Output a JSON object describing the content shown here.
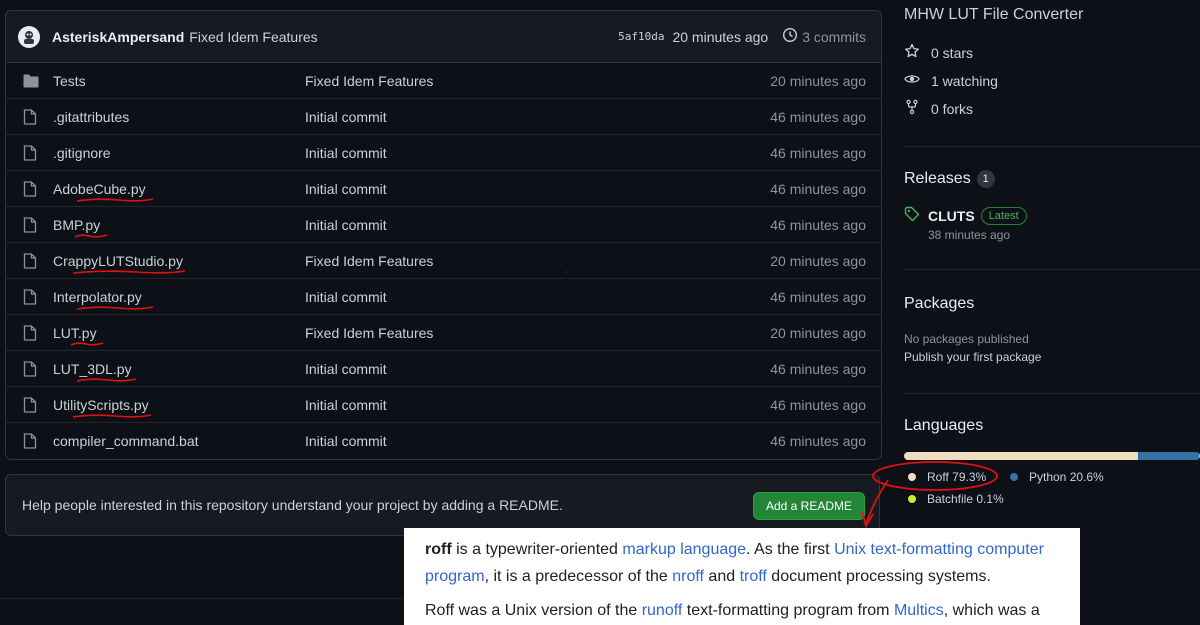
{
  "commit": {
    "author": "AsteriskAmpersand",
    "message": "Fixed Idem Features",
    "sha": "5af10da",
    "time": "20 minutes ago",
    "commits_label": "3 commits"
  },
  "files": [
    {
      "name": "Tests",
      "type": "folder",
      "message": "Fixed Idem Features",
      "time": "20 minutes ago",
      "underlined": false
    },
    {
      "name": ".gitattributes",
      "type": "file",
      "message": "Initial commit",
      "time": "46 minutes ago",
      "underlined": false
    },
    {
      "name": ".gitignore",
      "type": "file",
      "message": "Initial commit",
      "time": "46 minutes ago",
      "underlined": false
    },
    {
      "name": "AdobeCube.py",
      "type": "file",
      "message": "Initial commit",
      "time": "46 minutes ago",
      "underlined": true
    },
    {
      "name": "BMP.py",
      "type": "file",
      "message": "Initial commit",
      "time": "46 minutes ago",
      "underlined": true
    },
    {
      "name": "CrappyLUTStudio.py",
      "type": "file",
      "message": "Fixed Idem Features",
      "time": "20 minutes ago",
      "underlined": true
    },
    {
      "name": "Interpolator.py",
      "type": "file",
      "message": "Initial commit",
      "time": "46 minutes ago",
      "underlined": true
    },
    {
      "name": "LUT.py",
      "type": "file",
      "message": "Fixed Idem Features",
      "time": "20 minutes ago",
      "underlined": true
    },
    {
      "name": "LUT_3DL.py",
      "type": "file",
      "message": "Initial commit",
      "time": "46 minutes ago",
      "underlined": true
    },
    {
      "name": "UtilityScripts.py",
      "type": "file",
      "message": "Initial commit",
      "time": "46 minutes ago",
      "underlined": true
    },
    {
      "name": "compiler_command.bat",
      "type": "file",
      "message": "Initial commit",
      "time": "46 minutes ago",
      "underlined": false
    }
  ],
  "readme_prompt": {
    "text": "Help people interested in this repository understand your project by adding a README.",
    "button": "Add a README"
  },
  "sidebar": {
    "about": "MHW LUT File Converter",
    "stars": "0 stars",
    "watching": "1 watching",
    "forks": "0 forks",
    "releases_title": "Releases",
    "releases_count": "1",
    "release_name": "CLUTS",
    "release_badge": "Latest",
    "release_time": "38 minutes ago",
    "packages_title": "Packages",
    "packages_none": "No packages published",
    "packages_link": "Publish your first package",
    "languages_title": "Languages",
    "languages": [
      {
        "name": "Roff",
        "percent": "79.3%",
        "share": 79.3,
        "color": "#ecdebe"
      },
      {
        "name": "Python",
        "percent": "20.6%",
        "share": 20.6,
        "color": "#3572a5"
      },
      {
        "name": "Batchfile",
        "percent": "0.1%",
        "share": 0.1,
        "color": "#c1f12e"
      }
    ]
  },
  "wiki": {
    "p1": [
      {
        "t": "roff",
        "style": "bold"
      },
      {
        "t": " is a typewriter-oriented ",
        "style": "text"
      },
      {
        "t": "markup language",
        "style": "link"
      },
      {
        "t": ". As the first ",
        "style": "text"
      },
      {
        "t": "Unix text-formatting computer program",
        "style": "link"
      },
      {
        "t": ", it is a predecessor of the ",
        "style": "text"
      },
      {
        "t": "nroff",
        "style": "link"
      },
      {
        "t": " and ",
        "style": "text"
      },
      {
        "t": "troff",
        "style": "link"
      },
      {
        "t": " document processing systems.",
        "style": "text"
      }
    ],
    "p2": [
      {
        "t": "Roff was a Unix version of the ",
        "style": "text"
      },
      {
        "t": "runoff",
        "style": "link"
      },
      {
        "t": " text-formatting program from ",
        "style": "text"
      },
      {
        "t": "Multics",
        "style": "link"
      },
      {
        "t": ", which was a",
        "style": "text"
      }
    ]
  },
  "colors": {
    "background": "#0d1117",
    "annotation_red": "#e01010",
    "button_green": "#238636",
    "link_blue": "#3366cc"
  }
}
